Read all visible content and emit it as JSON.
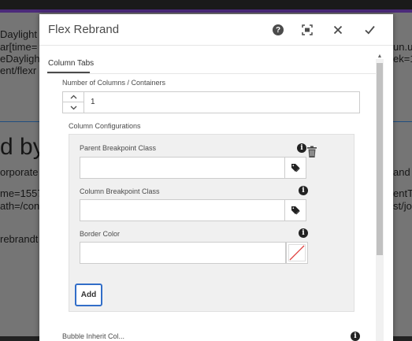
{
  "background": {
    "lines": [
      "Daylight",
      "ar[time=",
      "eDaylight",
      "ent/flexr",
      "d by",
      "orporate",
      "me=1557",
      "ath=/con",
      "rebrandt"
    ],
    "right_lines": [
      "un.u",
      "ek=1",
      "and",
      "entTy",
      "st/jo"
    ]
  },
  "dialog": {
    "title": "Flex Rebrand",
    "tab_label": "Column Tabs",
    "columns_label": "Number of Columns / Containers",
    "columns_value": "1",
    "config_label": "Column Configurations",
    "parent_breakpoint_label": "Parent Breakpoint Class",
    "parent_breakpoint_value": "",
    "column_breakpoint_label": "Column Breakpoint Class",
    "column_breakpoint_value": "",
    "border_color_label": "Border Color",
    "border_color_value": "",
    "add_label": "Add",
    "next_section_label": "Bubble Inherit Col..."
  },
  "icons": {
    "help": "help-icon",
    "fullscreen": "fullscreen-icon",
    "close": "close-icon",
    "done": "checkmark-icon",
    "info": "info-icon",
    "trash": "trash-icon",
    "tag": "tag-icon",
    "color_swatch": "no-color-swatch-icon"
  },
  "colors": {
    "accent": "#326ec8",
    "header_bar": "#4b2a7a"
  }
}
